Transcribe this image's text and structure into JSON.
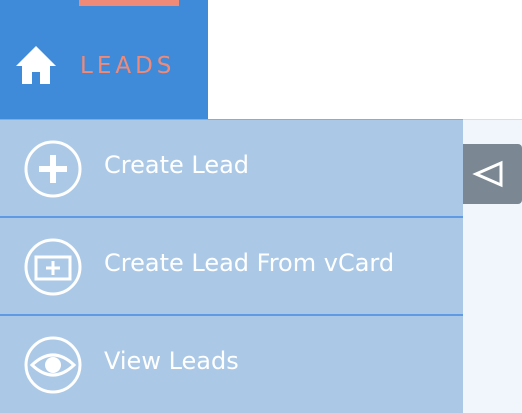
{
  "header": {
    "title": "LEADS",
    "icon": "home-icon",
    "colors": {
      "background": "#3f8bd9",
      "accent": "#f08a78"
    }
  },
  "menu": {
    "items": [
      {
        "label": "Create Lead",
        "icon": "plus-circle-icon"
      },
      {
        "label": "Create Lead From vCard",
        "icon": "vcard-add-icon"
      },
      {
        "label": "View Leads",
        "icon": "eye-icon"
      }
    ],
    "colors": {
      "background": "#abc9e6",
      "divider": "#5e9be4",
      "text": "#ffffff"
    }
  },
  "collapse_toggle": {
    "icon": "triangle-left-icon",
    "color": "#7b8893"
  }
}
